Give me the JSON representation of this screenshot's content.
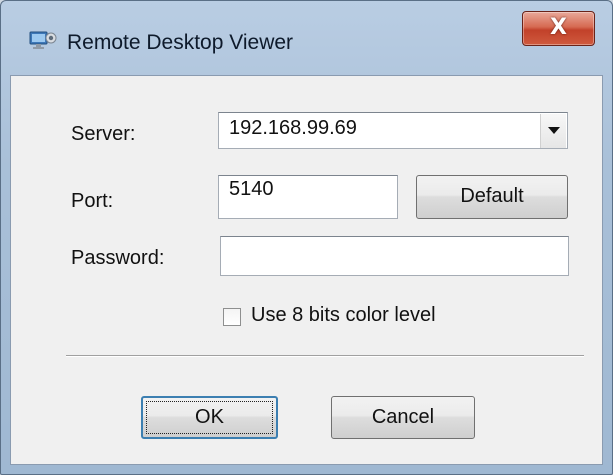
{
  "window": {
    "title": "Remote Desktop Viewer",
    "close_label": "X"
  },
  "form": {
    "server_label": "Server:",
    "server_value": "192.168.99.69",
    "port_label": "Port:",
    "port_value": "5140",
    "default_button": "Default",
    "password_label": "Password:",
    "password_value": "",
    "color_checkbox_label": "Use 8 bits color level",
    "color_checkbox_checked": false
  },
  "buttons": {
    "ok": "OK",
    "cancel": "Cancel"
  },
  "icons": {
    "title": "remote-desktop-icon",
    "close": "close-icon",
    "dropdown": "chevron-down-icon"
  }
}
